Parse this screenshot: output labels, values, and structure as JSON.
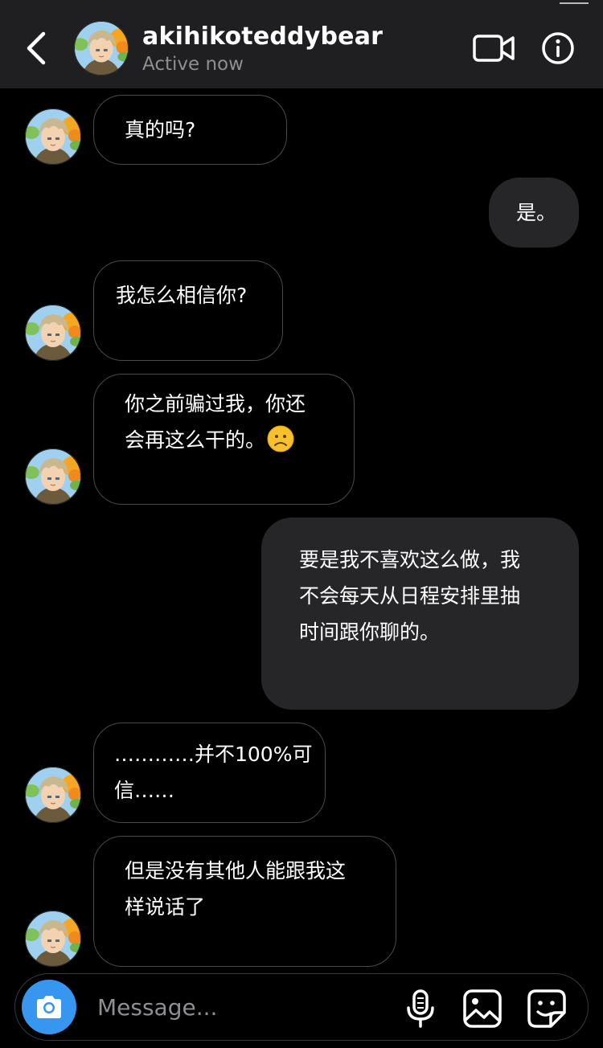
{
  "header": {
    "username": "akihikoteddybear",
    "status": "Active now",
    "back_icon": "chevron-left-icon",
    "video_icon": "video-camera-icon",
    "info_icon": "info-icon"
  },
  "messages": [
    {
      "direction": "incoming",
      "text": "真的吗?"
    },
    {
      "direction": "outgoing",
      "text": "是。"
    },
    {
      "direction": "incoming",
      "text": "我怎么相信你?"
    },
    {
      "direction": "incoming",
      "text": "你之前骗过我，你还\n会再这么干的。",
      "emoji": "frowning-face"
    },
    {
      "direction": "outgoing",
      "text": "要是我不喜欢这么做，我\n不会每天从日程安排里抽\n时间跟你聊的。"
    },
    {
      "direction": "incoming",
      "text": "…………并不100%可\n信……"
    },
    {
      "direction": "incoming",
      "text": "但是没有其他人能跟我这\n样说话了"
    }
  ],
  "composer": {
    "placeholder": "Message...",
    "camera_icon": "camera-icon",
    "mic_icon": "microphone-icon",
    "gallery_icon": "image-icon",
    "sticker_icon": "sticker-icon"
  },
  "colors": {
    "background": "#000000",
    "header_bg": "#1f1f21",
    "outgoing_bubble": "#262628",
    "incoming_border": "#4a4a4a",
    "accent": "#3797f0",
    "muted_text": "#8e8e93"
  }
}
